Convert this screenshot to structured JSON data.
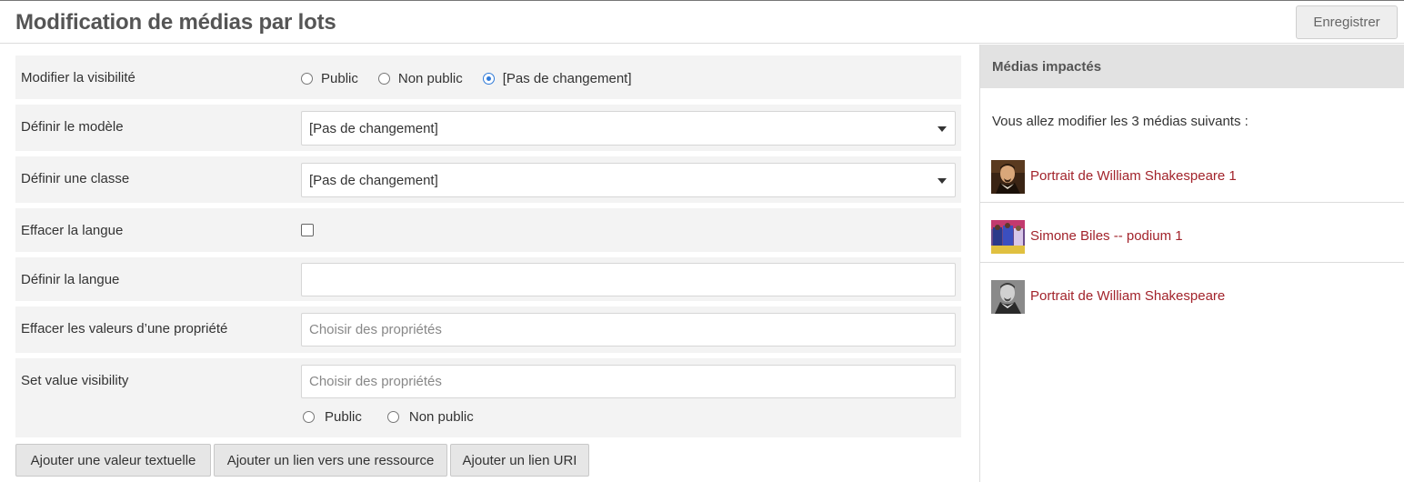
{
  "header": {
    "title": "Modification de médias par lots",
    "save_label": "Enregistrer"
  },
  "form": {
    "visibility": {
      "label": "Modifier la visibilité",
      "options": [
        "Public",
        "Non public",
        "[Pas de changement]"
      ],
      "selected": "[Pas de changement]"
    },
    "template": {
      "label": "Définir le modèle",
      "value": "[Pas de changement]"
    },
    "class": {
      "label": "Définir une classe",
      "value": "[Pas de changement]"
    },
    "clear_language": {
      "label": "Effacer la langue",
      "checked": false
    },
    "set_language": {
      "label": "Définir la langue",
      "value": ""
    },
    "clear_property_values": {
      "label": "Effacer les valeurs d’une propriété",
      "placeholder": "Choisir des propriétés"
    },
    "set_value_visibility": {
      "label": "Set value visibility",
      "placeholder": "Choisir des propriétés",
      "options": [
        "Public",
        "Non public"
      ]
    }
  },
  "buttons": {
    "add_text": "Ajouter une valeur textuelle",
    "add_resource_link": "Ajouter un lien vers une ressource",
    "add_uri": "Ajouter un lien URI"
  },
  "sidebar": {
    "title": "Médias impactés",
    "intro": "Vous allez modifier les 3 médias suivants :",
    "items": [
      {
        "title": "Portrait de William Shakespeare 1",
        "thumb": "shakespeare-color-icon"
      },
      {
        "title": "Simone Biles -- podium 1",
        "thumb": "podium-photo-icon"
      },
      {
        "title": "Portrait de William Shakespeare",
        "thumb": "shakespeare-bw-icon"
      }
    ]
  },
  "colors": {
    "link": "#a2232b",
    "radio_active": "#2f7ad8",
    "row_background": "#f3f3f3",
    "sidebar_header": "#e2e2e2"
  }
}
